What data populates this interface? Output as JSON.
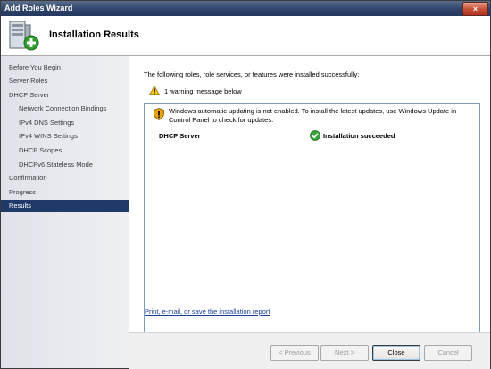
{
  "window": {
    "title": "Add Roles Wizard",
    "close_glyph": "×"
  },
  "header": {
    "title": "Installation Results",
    "icon": "server-add-icon"
  },
  "sidebar": {
    "items": [
      {
        "label": "Before You Begin",
        "level": 0,
        "active": false
      },
      {
        "label": "Server Roles",
        "level": 0,
        "active": false
      },
      {
        "label": "DHCP Server",
        "level": 0,
        "active": false
      },
      {
        "label": "Network Connection Bindings",
        "level": 1,
        "active": false
      },
      {
        "label": "IPv4 DNS Settings",
        "level": 1,
        "active": false
      },
      {
        "label": "IPv4 WINS Settings",
        "level": 1,
        "active": false
      },
      {
        "label": "DHCP Scopes",
        "level": 1,
        "active": false
      },
      {
        "label": "DHCPv6 Stateless Mode",
        "level": 1,
        "active": false
      },
      {
        "label": "Confirmation",
        "level": 0,
        "active": false
      },
      {
        "label": "Progress",
        "level": 0,
        "active": false
      },
      {
        "label": "Results",
        "level": 0,
        "active": true
      }
    ]
  },
  "main": {
    "intro": "The following roles, role services, or features were installed successfully:",
    "warning_summary": "1 warning message below",
    "results": {
      "message": "Windows automatic updating is not enabled. To install the latest updates, use Windows Update in Control Panel to check for updates.",
      "role_name": "DHCP Server",
      "status": "Installation succeeded"
    },
    "report_link": "Print, e-mail, or save the installation report"
  },
  "footer": {
    "previous": "< Previous",
    "next": "Next >",
    "close": "Close",
    "cancel": "Cancel"
  },
  "colors": {
    "active_nav": "#1f3a68",
    "link": "#1a3e9a",
    "titlebar": "#2f4468"
  }
}
